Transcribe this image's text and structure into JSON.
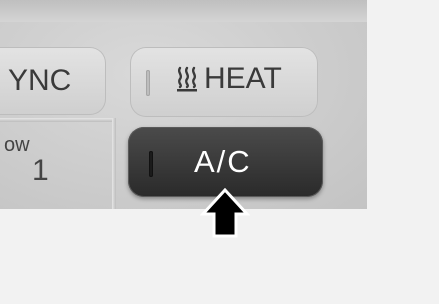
{
  "panel": {
    "buttons": {
      "sync": {
        "label": "YNC"
      },
      "heat": {
        "label": "HEAT",
        "icon": "heat-icon"
      },
      "ac": {
        "label": "A/C"
      }
    },
    "fan": {
      "label": "ow",
      "value": "1"
    }
  },
  "colors": {
    "panel_background": "#cfcfcf",
    "ac_button": "#333333",
    "ac_text": "#ffffff",
    "button_text": "#3a3a3a",
    "page_background": "#f2f2f2"
  },
  "pointer": {
    "icon": "arrow-up-icon"
  }
}
